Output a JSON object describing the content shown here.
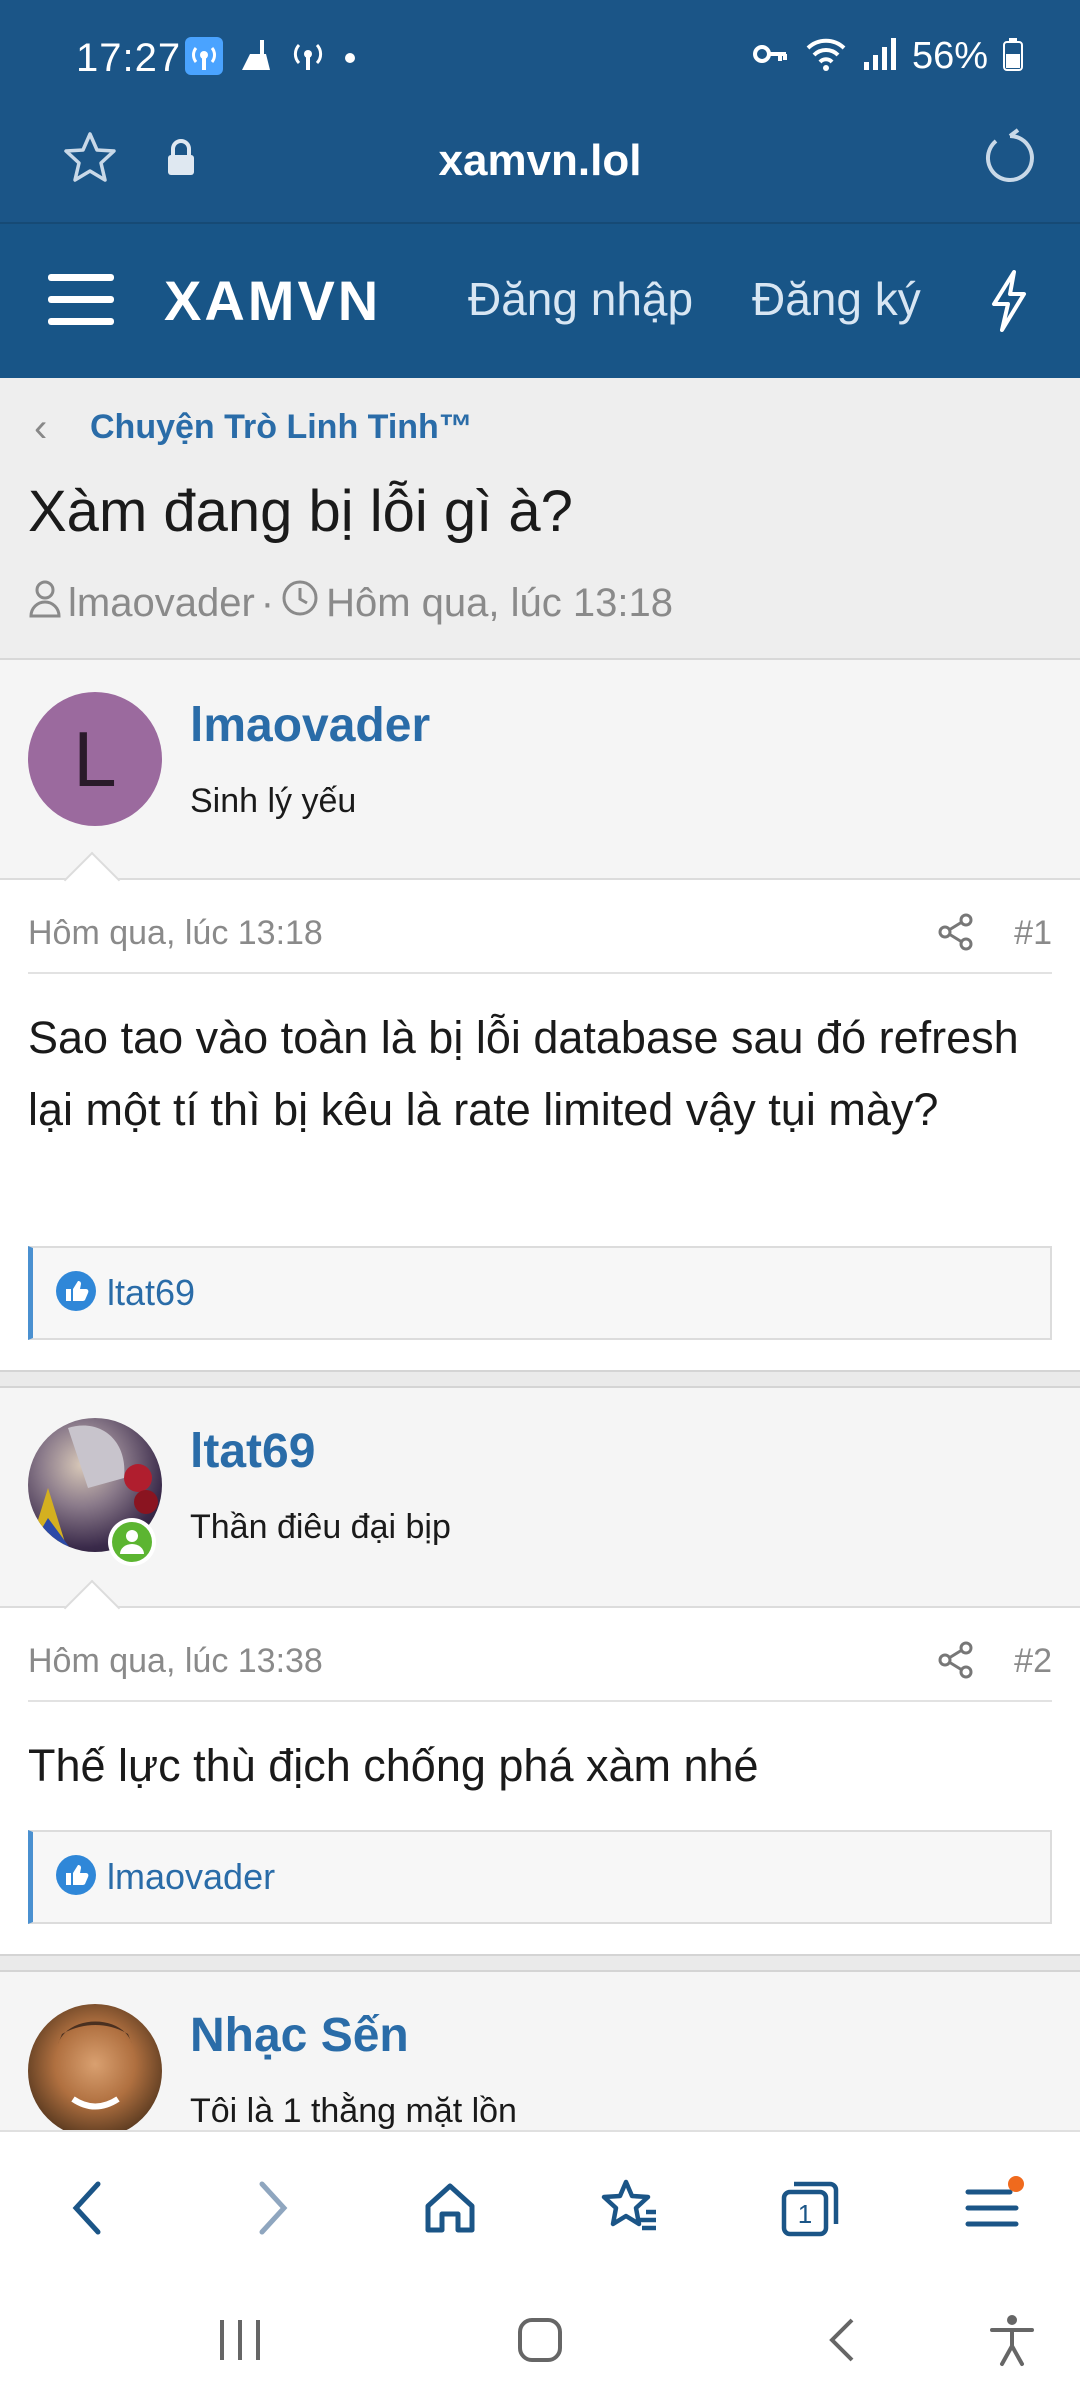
{
  "status_bar": {
    "time": "17:27",
    "battery": "56%"
  },
  "browser": {
    "url": "xamvn.lol"
  },
  "site_header": {
    "logo": "XAMVN",
    "login": "Đăng nhập",
    "register": "Đăng ký"
  },
  "thread": {
    "breadcrumb": "Chuyện Trò Linh Tinh™",
    "title": "Xàm đang bị lỗi gì à?",
    "author": "lmaovader",
    "meta_sep": "·",
    "time": "Hôm qua, lúc 13:18"
  },
  "posts": [
    {
      "avatar_letter": "L",
      "username": "lmaovader",
      "user_title": "Sinh lý yếu",
      "date": "Hôm qua, lúc 13:18",
      "number": "#1",
      "text": "Sao tao vào toàn là bị lỗi database sau đó refresh lại một tí thì bị kêu là rate limited vậy tụi mày?",
      "reaction_user": "ltat69"
    },
    {
      "username": "ltat69",
      "user_title": "Thần điêu đại bịp",
      "date": "Hôm qua, lúc 13:38",
      "number": "#2",
      "text": "Thế lực thù địch chống phá xàm nhé",
      "reaction_user": "lmaovader"
    },
    {
      "username": "Nhạc Sến",
      "user_title": "Tôi là 1 thằng mặt lồn"
    }
  ],
  "colors": {
    "header_bg": "#1b5587",
    "link_blue": "#2a6ca8",
    "avatar_purple": "#9b6a9e",
    "online_green": "#5cb531",
    "notification_dot": "#f06a1d"
  }
}
